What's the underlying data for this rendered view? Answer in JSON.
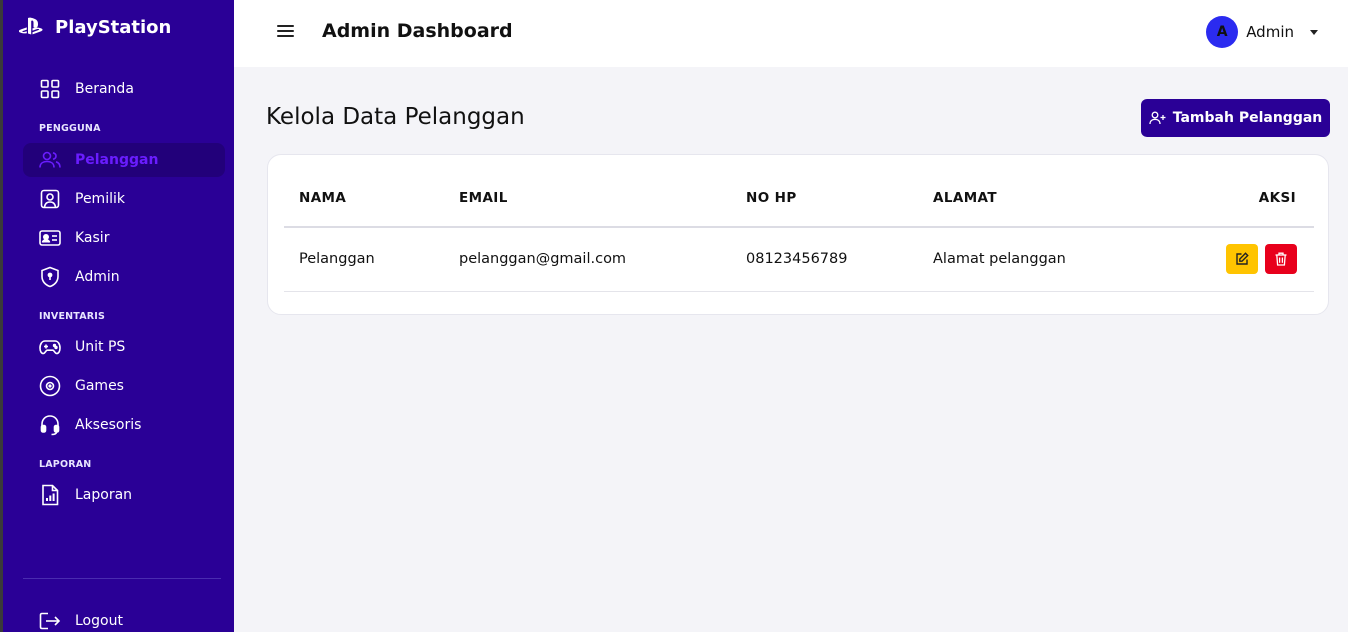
{
  "brand": {
    "name": "PlayStation"
  },
  "sidebar": {
    "items": [
      {
        "label": "Beranda",
        "icon": "grid-icon"
      },
      {
        "label": "Pelanggan",
        "icon": "users-icon",
        "active": true
      },
      {
        "label": "Pemilik",
        "icon": "user-square-icon"
      },
      {
        "label": "Kasir",
        "icon": "id-card-icon"
      },
      {
        "label": "Admin",
        "icon": "shield-icon"
      },
      {
        "label": "Unit PS",
        "icon": "gamepad-icon"
      },
      {
        "label": "Games",
        "icon": "disc-icon"
      },
      {
        "label": "Aksesoris",
        "icon": "headset-icon"
      },
      {
        "label": "Laporan",
        "icon": "report-icon"
      }
    ],
    "sections": [
      "PENGGUNA",
      "INVENTARIS",
      "LAPORAN"
    ],
    "logout_label": "Logout"
  },
  "topbar": {
    "title": "Admin Dashboard",
    "user": {
      "initial": "A",
      "name": "Admin"
    }
  },
  "main": {
    "title": "Kelola Data Pelanggan",
    "add_button_label": "Tambah Pelanggan",
    "table": {
      "columns": [
        "NAMA",
        "EMAIL",
        "NO HP",
        "ALAMAT",
        "AKSI"
      ],
      "rows": [
        {
          "nama": "Pelanggan",
          "email": "pelanggan@gmail.com",
          "no_hp": "08123456789",
          "alamat": "Alamat pelanggan"
        }
      ]
    }
  },
  "colors": {
    "sidebar_bg": "#2a0096",
    "active_item_bg": "#22007a",
    "active_item_text": "#6a1cff",
    "edit_button": "#ffc400",
    "delete_button": "#e8001c",
    "avatar_bg": "#2b2bf0"
  }
}
